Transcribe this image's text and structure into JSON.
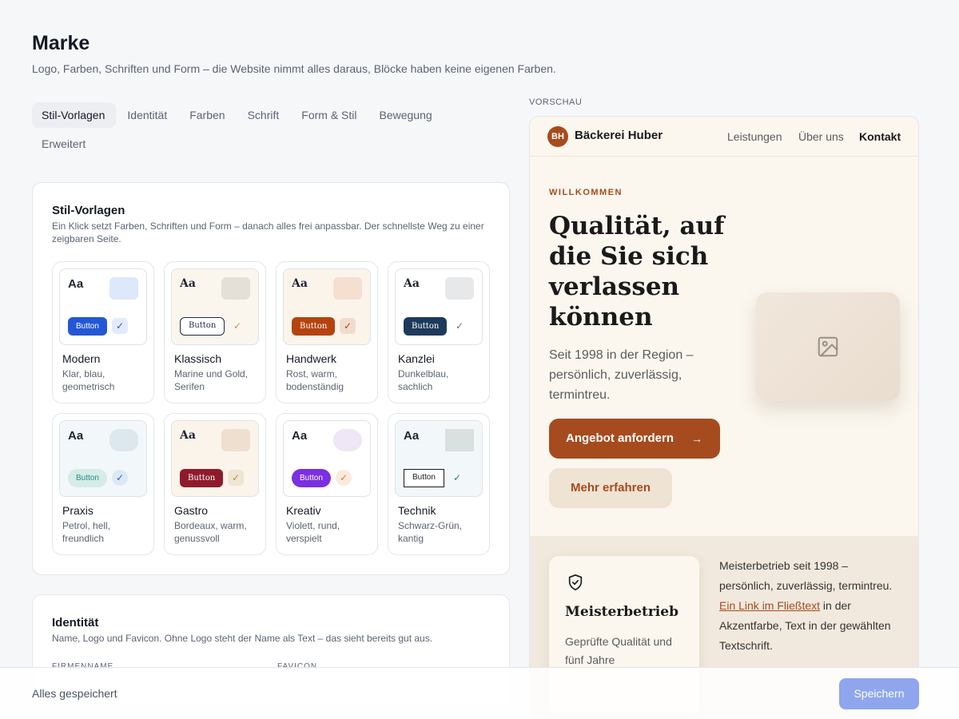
{
  "header": {
    "title": "Marke",
    "subtitle": "Logo, Farben, Schriften und Form – die Website nimmt alles daraus, Blöcke haben keine eigenen Farben."
  },
  "tabs": [
    {
      "label": "Stil-Vorlagen",
      "active": true
    },
    {
      "label": "Identität"
    },
    {
      "label": "Farben"
    },
    {
      "label": "Schrift"
    },
    {
      "label": "Form & Stil"
    },
    {
      "label": "Bewegung"
    },
    {
      "label": "Erweitert"
    }
  ],
  "presets_card": {
    "title": "Stil-Vorlagen",
    "description": "Ein Klick setzt Farben, Schriften und Form – danach alles frei anpassbar. Der schnellste Weg zu einer zeigbaren Seite.",
    "items": [
      {
        "name": "Modern",
        "desc": "Klar, blau, geometrisch",
        "aa": "Aa",
        "button": "Button",
        "check": "✓",
        "accent": "#2457d6",
        "block": "#dde8fb",
        "bg": "#ffffff",
        "checkbg": "#e3ebfb",
        "checkcolor": "#2457d6",
        "serif": false,
        "outline": false
      },
      {
        "name": "Klassisch",
        "desc": "Marine und Gold, Serifen",
        "aa": "Aa",
        "button": "Button",
        "check": "✓",
        "accent": "#1e2a44",
        "block": "#e5e0d7",
        "bg": "#faf6ee",
        "checkbg": "transparent",
        "checkcolor": "#c2943f",
        "serif": true,
        "outline": true
      },
      {
        "name": "Handwerk",
        "desc": "Rost, warm, bodenständig",
        "aa": "Aa",
        "button": "Button",
        "check": "✓",
        "accent": "#b5430f",
        "block": "#f4dfd1",
        "bg": "#fbf4ea",
        "checkbg": "#f0dccd",
        "checkcolor": "#b5430f",
        "serif": true,
        "outline": false
      },
      {
        "name": "Kanzlei",
        "desc": "Dunkelblau, sachlich",
        "aa": "Aa",
        "button": "Button",
        "check": "✓",
        "accent": "#1d3a5c",
        "block": "#e7e8ea",
        "bg": "#ffffff",
        "checkbg": "transparent",
        "checkcolor": "#6b7280",
        "serif": true,
        "outline": false
      },
      {
        "name": "Praxis",
        "desc": "Petrol, hell, freundlich",
        "aa": "Aa",
        "button": "Button",
        "check": "✓",
        "accent": "#2b8a86",
        "block": "#dde8ee",
        "bg": "#f2f8fa",
        "checkbg": "#dce8f5",
        "checkcolor": "#2457d6",
        "serif": false,
        "outline": false,
        "soft": true
      },
      {
        "name": "Gastro",
        "desc": "Bordeaux, warm, genussvoll",
        "aa": "Aa",
        "button": "Button",
        "check": "✓",
        "accent": "#8e1b2c",
        "block": "#efdfcf",
        "bg": "#fbf4ea",
        "checkbg": "#efe5d3",
        "checkcolor": "#b88a3e",
        "serif": true,
        "outline": false
      },
      {
        "name": "Kreativ",
        "desc": "Violett, rund, verspielt",
        "aa": "Aa",
        "button": "Button",
        "check": "✓",
        "accent": "#7b2fe0",
        "block": "#efe6f6",
        "bg": "#ffffff",
        "checkbg": "#fbeadf",
        "checkcolor": "#d9782e",
        "serif": false,
        "outline": false,
        "pill": true
      },
      {
        "name": "Technik",
        "desc": "Schwarz-Grün, kantig",
        "aa": "Aa",
        "button": "Button",
        "check": "✓",
        "accent": "#1a1a1a",
        "block": "#d8e0e0",
        "bg": "#f2f8fa",
        "checkbg": "transparent",
        "checkcolor": "#1f8a4c",
        "serif": false,
        "outline": true,
        "square": true
      }
    ]
  },
  "identity_card": {
    "title": "Identität",
    "description": "Name, Logo und Favicon. Ohne Logo steht der Name als Text – das sieht bereits gut aus.",
    "field_company": "FIRMENNAME",
    "field_favicon": "FAVICON"
  },
  "preview": {
    "label": "VORSCHAU",
    "logo_initials": "BH",
    "brand": "Bäckerei Huber",
    "nav": [
      "Leistungen",
      "Über uns",
      "Kontakt"
    ],
    "kicker": "WILLKOMMEN",
    "headline": "Qualität, auf die Sie sich verlassen können",
    "lead": "Seit 1998 in der Region – persönlich, zuverlässig, termintreu.",
    "cta_primary": "Angebot anfordern",
    "cta_arrow": "→",
    "cta_secondary": "Mehr erfahren",
    "feature_title": "Meisterbetrieb",
    "feature_text": "Geprüfte Qualität und fünf Jahre",
    "body_before": "Meisterbetrieb seit 1998 – persönlich, zuverlässig, termintreu. ",
    "body_link": "Ein Link im Fließtext",
    "body_after": " in der Akzentfarbe, Text in der gewählten Textschrift.",
    "colors": {
      "accent": "#a64b1e",
      "background": "#fbf7ef"
    }
  },
  "footer": {
    "status": "Alles gespeichert",
    "save": "Speichern"
  }
}
